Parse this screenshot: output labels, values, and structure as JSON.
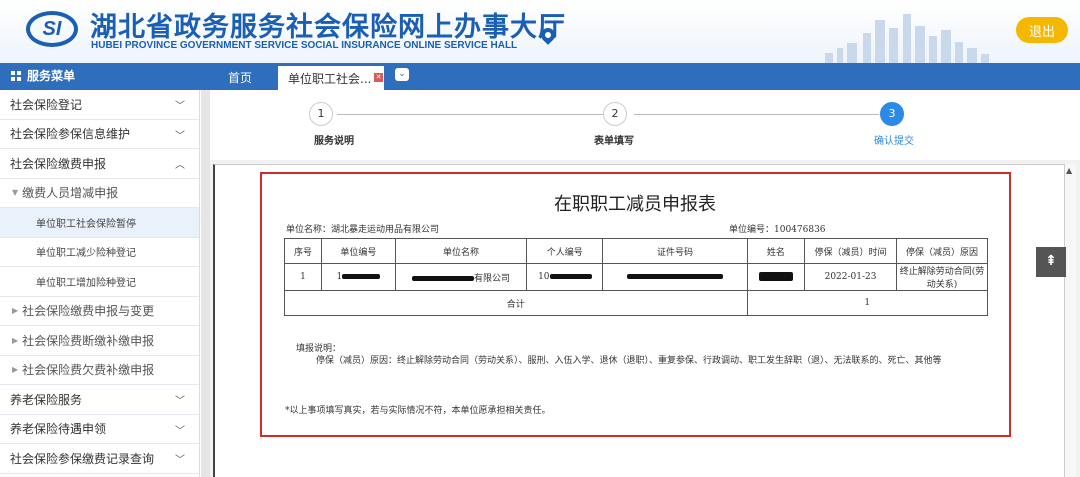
{
  "header": {
    "logo_text": "SI",
    "title_cn": "湖北省政务服务社会保险网上办事大厅",
    "title_en": "HUBEI PROVINCE GOVERNMENT SERVICE SOCIAL INSURANCE ONLINE SERVICE HALL",
    "logout_label": "退出"
  },
  "navbar": {
    "menu_title": "服务菜单",
    "tabs": [
      {
        "label": "首页"
      },
      {
        "label": "单位职工社会..."
      }
    ]
  },
  "sidebar": {
    "items": [
      {
        "label": "社会保险登记",
        "chev": "﹀"
      },
      {
        "label": "社会保险参保信息维护",
        "chev": "﹀"
      },
      {
        "label": "社会保险缴费申报",
        "chev": "︿"
      },
      {
        "label": "缴费人员增减申报"
      },
      {
        "label": "单位职工社会保险暂停"
      },
      {
        "label": "单位职工减少险种登记"
      },
      {
        "label": "单位职工增加险种登记"
      },
      {
        "label": "社会保险缴费申报与变更"
      },
      {
        "label": "社会保险费断缴补缴申报"
      },
      {
        "label": "社会保险费欠费补缴申报"
      },
      {
        "label": "养老保险服务",
        "chev": "﹀"
      },
      {
        "label": "养老保险待遇申领",
        "chev": "﹀"
      },
      {
        "label": "社会保险参保缴费记录查询",
        "chev": "﹀"
      }
    ]
  },
  "steps": [
    {
      "num": "1",
      "label": "服务说明"
    },
    {
      "num": "2",
      "label": "表单填写"
    },
    {
      "num": "3",
      "label": "确认提交"
    }
  ],
  "document": {
    "title": "在职职工减员申报表",
    "unit_name": "单位名称：湖北暴走运动用品有限公司",
    "unit_no": "单位编号：100476836",
    "columns": [
      "序号",
      "单位编号",
      "单位名称",
      "个人编号",
      "证件号码",
      "姓名",
      "停保（减员）时间",
      "停保（减员）原因"
    ],
    "row": {
      "seq": "1",
      "unit_no_prefix": "1",
      "unit_name_suffix": "有限公司",
      "person_no_prefix": "10",
      "date": "2022-01-23",
      "reason": "终止解除劳动合同(劳动关系)"
    },
    "total_label": "合计",
    "total_value": "1",
    "note_label": "填报说明：",
    "note_text": "停保（减员）原因：终止解除劳动合同（劳动关系）、服刑、入伍入学、退休（退职）、重复参保、行政调动、职工发生辞职（退）、无法联系的、死亡、其他等",
    "footer_note": "*以上事项填写真实，若与实际情况不符，本单位愿承担相关责任。"
  },
  "colors": {
    "brand_blue": "#1a5fb4",
    "nav_blue": "#2f6ebd",
    "step_active": "#2a8ae6",
    "highlight_red": "#d42a2a",
    "logout_yellow": "#f5b800"
  }
}
